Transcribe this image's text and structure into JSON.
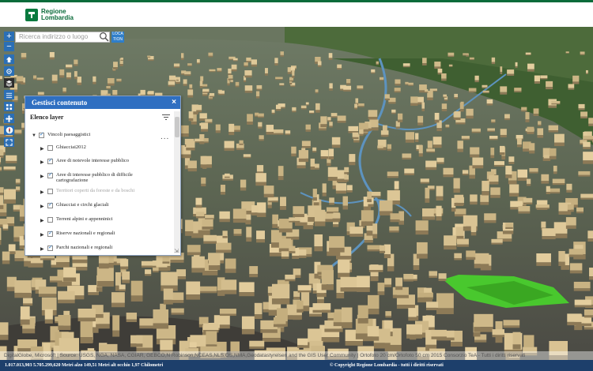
{
  "header": {
    "logo_name": "Regione",
    "logo_region": "Lombardia"
  },
  "search": {
    "placeholder": "Ricerca indirizzo o luogo",
    "location_label_1": "LOCA",
    "location_label_2": "TION"
  },
  "toolbar": {
    "zoom_in": "+",
    "zoom_out": "−",
    "icons": [
      "home-icon",
      "locate-icon",
      "layers-icon",
      "list-icon",
      "grid-icon",
      "pan-icon",
      "compass-icon",
      "fullscreen-icon"
    ]
  },
  "panel": {
    "title": "Gestisci contenuto",
    "close_label": "×",
    "section_title": "Elenco layer",
    "group_label": "Vincoli paesaggistici",
    "menu_label": "...",
    "layers": [
      {
        "label_line1": "Ghiacciai2012",
        "checked": false,
        "disabled": false
      },
      {
        "label_line1": "Aree di notevole interesse pubblico",
        "checked": true,
        "disabled": false
      },
      {
        "label_line1": "Aree di interesse pubblico di difficile",
        "label_line2": "cartografazione",
        "checked": true,
        "disabled": false
      },
      {
        "label_line1": "Territori coperti da foreste e da boschi",
        "checked": false,
        "disabled": true
      },
      {
        "label_line1": "Ghiacciai e circhi glaciali",
        "checked": true,
        "disabled": false
      },
      {
        "label_line1": "Terreni alpini e appenninici",
        "checked": false,
        "disabled": false
      },
      {
        "label_line1": "Riserve nazionali e regionali",
        "checked": true,
        "disabled": false
      },
      {
        "label_line1": "Parchi nazionali e regionali",
        "checked": true,
        "disabled": false
      }
    ]
  },
  "attribution": "DigitalGlobe, Microsoft | Source: USGS, NGA, NASA, CGIAR, GEBCO,N Robinson,NCEAS,NLS,OS,NMA,Geodatastyrelsen and the GIS User Community | Ortofoto 20 cm/Ortofoto 50 cm 2015 Consorzio TeA - Tutti i diritti riservati",
  "footer": {
    "coords": "1.017.013,903 5.705.299,620 Metri  alzo 149,51 Metri   alt occhio 1,97 Chilometri",
    "copyright": "© Copyright Regione Lombardia - tutti i diritti riservati"
  },
  "colors": {
    "header_accent": "#0a6b3a",
    "footer_bg": "#1d3f6b",
    "panel_header": "#2f6fc1",
    "toolbar_bg": "#2b6fb6",
    "building": "#d8c497",
    "park": "#49c82e"
  }
}
